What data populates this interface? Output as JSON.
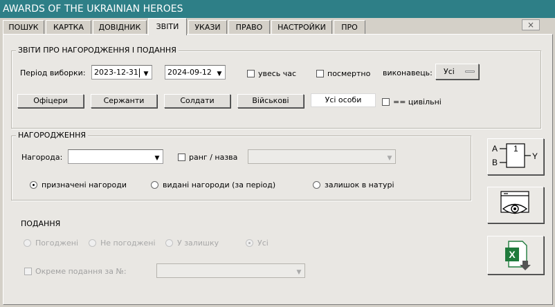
{
  "window": {
    "title": "AWARDS OF THE UKRAINIAN HEROES",
    "close_glyph": "×"
  },
  "tabs": [
    {
      "label": "ПОШУК",
      "active": false
    },
    {
      "label": "КАРТКА",
      "active": false
    },
    {
      "label": "ДОВІДНИК",
      "active": false
    },
    {
      "label": "ЗВІТИ",
      "active": true
    },
    {
      "label": "УКАЗИ",
      "active": false
    },
    {
      "label": "ПРАВО",
      "active": false
    },
    {
      "label": "НАСТРОЙКИ",
      "active": false
    },
    {
      "label": "ПРО",
      "active": false
    }
  ],
  "reports": {
    "legend": "ЗВІТИ ПРО НАГОРОДЖЕННЯ І ПОДАННЯ",
    "period_label": "Період виборки:",
    "date_from": "2023-12-31",
    "date_to": "2024-09-12",
    "all_time_label": "увесь час",
    "posthumous_label": "посмертно",
    "executor_label": "виконавець:",
    "executor_value": "Усі",
    "buttons": {
      "officers": "Офіцери",
      "sergeants": "Сержанти",
      "soldiers": "Солдати",
      "military": "Військові",
      "all_persons": "Усі особи"
    },
    "civilians_label": "== цивільні"
  },
  "awards": {
    "legend": "НАГОРОДЖЕННЯ",
    "award_label": "Нагорода:",
    "award_value": "",
    "rank_label": "ранг / назва",
    "rank_value": "",
    "radio_assigned": "призначені нагороди",
    "radio_issued": "видані нагороди (за період)",
    "radio_remaining": "залишок в натурі",
    "selected": "assigned"
  },
  "submissions": {
    "title": "ПОДАННЯ",
    "radio_agreed": "Погоджені",
    "radio_not_agreed": "Не погоджені",
    "radio_remaining": "У залишку",
    "radio_all": "Усі",
    "selected": "all",
    "separate_label": "Окреме подання за №:",
    "separate_value": ""
  },
  "side_buttons": {
    "logic": {
      "input_a": "A",
      "input_b": "B",
      "gate": "1",
      "output": "Y"
    },
    "preview_icon": "eye-preview-icon",
    "excel_icon": "excel-export-icon",
    "excel_letter": "X"
  },
  "colors": {
    "titlebar": "#2e7f87",
    "panel": "#e9e7e3",
    "excel_green": "#1f7a3c"
  }
}
